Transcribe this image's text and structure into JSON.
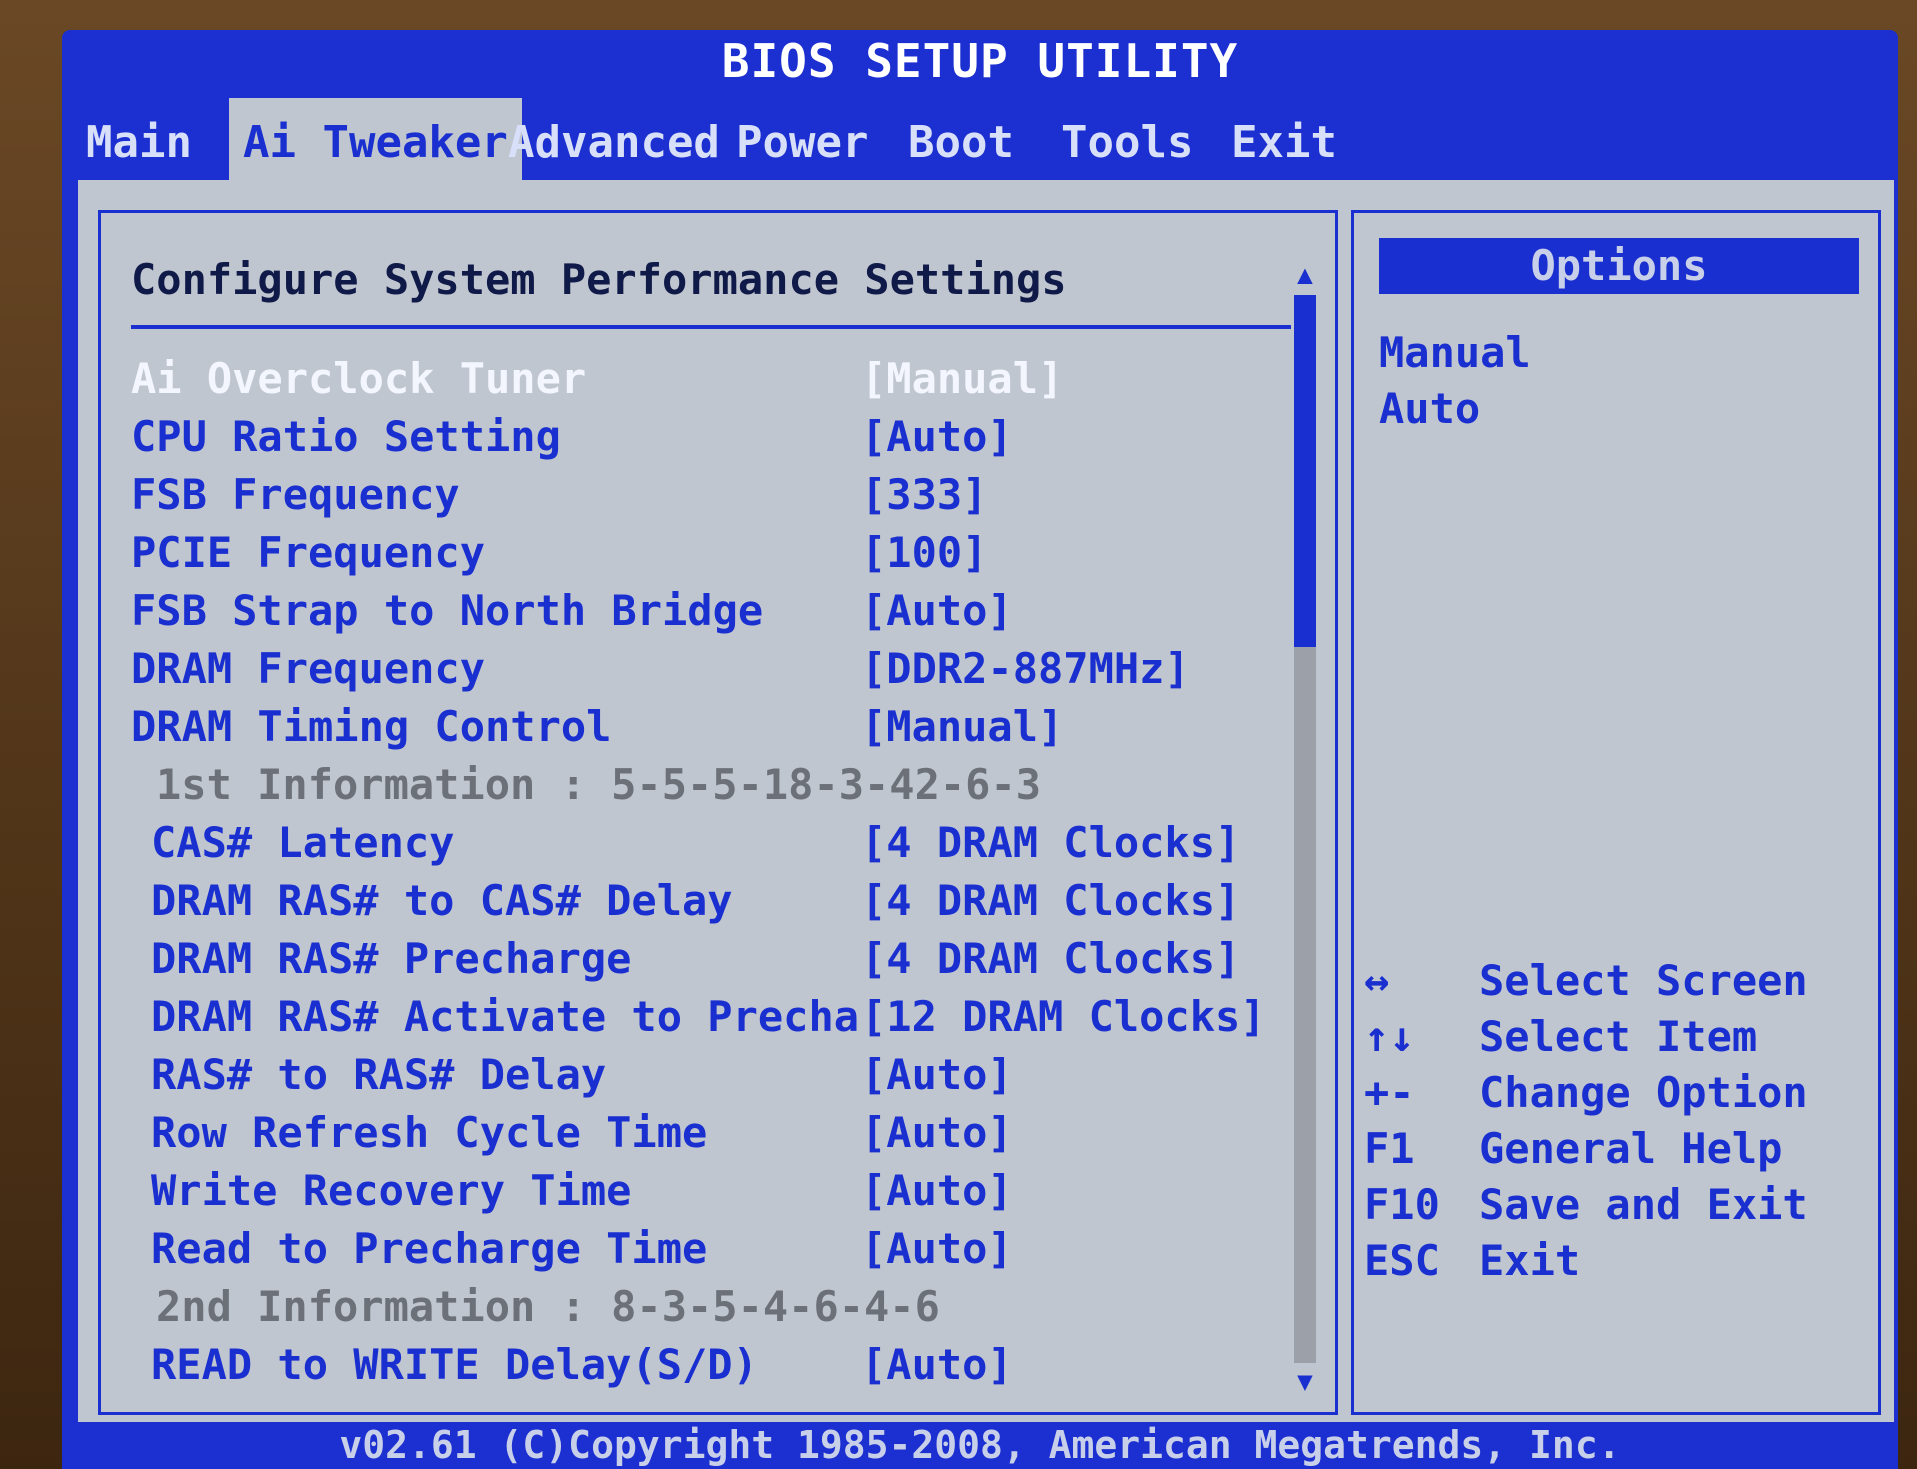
{
  "window": {
    "title": "BIOS SETUP UTILITY"
  },
  "menu": [
    {
      "label": "Main",
      "active": false
    },
    {
      "label": "Ai Tweaker",
      "active": true
    },
    {
      "label": "Advanced",
      "active": false
    },
    {
      "label": "Power",
      "active": false
    },
    {
      "label": "Boot",
      "active": false
    },
    {
      "label": "Tools",
      "active": false
    },
    {
      "label": "Exit",
      "active": false
    }
  ],
  "main": {
    "heading": "Configure System Performance Settings",
    "settings": [
      {
        "label": "Ai Overclock Tuner",
        "value": "[Manual]",
        "state": "highlighted"
      },
      {
        "label": "CPU Ratio Setting",
        "value": "[Auto]",
        "state": "normal"
      },
      {
        "label": "FSB Frequency",
        "value": "[333]",
        "state": "normal"
      },
      {
        "label": "PCIE Frequency",
        "value": "[100]",
        "state": "normal"
      },
      {
        "label": "FSB Strap to North Bridge",
        "value": "[Auto]",
        "state": "normal"
      },
      {
        "label": "DRAM Frequency",
        "value": "[DDR2-887MHz]",
        "state": "normal"
      },
      {
        "label": "DRAM Timing Control",
        "value": "[Manual]",
        "state": "normal"
      },
      {
        "label": "1st Information : 5-5-5-18-3-42-6-3",
        "value": "",
        "state": "info"
      },
      {
        "label": "CAS# Latency",
        "value": "[4 DRAM Clocks]",
        "state": "normal"
      },
      {
        "label": "DRAM RAS# to CAS# Delay",
        "value": "[4 DRAM Clocks]",
        "state": "normal"
      },
      {
        "label": "DRAM RAS# Precharge",
        "value": "[4 DRAM Clocks]",
        "state": "normal"
      },
      {
        "label": "DRAM RAS# Activate to Precha",
        "value": "[12 DRAM Clocks]",
        "state": "normal"
      },
      {
        "label": "RAS# to RAS# Delay",
        "value": "[Auto]",
        "state": "normal"
      },
      {
        "label": "Row Refresh Cycle Time",
        "value": "[Auto]",
        "state": "normal"
      },
      {
        "label": "Write Recovery Time",
        "value": "[Auto]",
        "state": "normal"
      },
      {
        "label": "Read to Precharge Time",
        "value": "[Auto]",
        "state": "normal"
      },
      {
        "label": "2nd Information : 8-3-5-4-6-4-6",
        "value": "",
        "state": "info"
      },
      {
        "label": "READ to WRITE Delay(S/D)",
        "value": "[Auto]",
        "state": "normal"
      }
    ],
    "scrollbar": {
      "up_icon": "up-arrow-icon",
      "down_icon": "down-arrow-icon",
      "position": 0.33
    }
  },
  "options_panel": {
    "heading": "Options",
    "options": [
      "Manual",
      "Auto"
    ],
    "keys": [
      {
        "key": "↔",
        "desc": "Select Screen"
      },
      {
        "key": "↑↓",
        "desc": "Select Item"
      },
      {
        "key": "+-",
        "desc": "Change Option"
      },
      {
        "key": "F1",
        "desc": "General Help"
      },
      {
        "key": "F10",
        "desc": "Save and Exit"
      },
      {
        "key": "ESC",
        "desc": "Exit"
      }
    ]
  },
  "footer": {
    "text": "v02.61 (C)Copyright 1985-2008, American Megatrends, Inc."
  },
  "colors": {
    "bios_blue": "#1a2fd0",
    "panel_grey": "#c0c6cf",
    "highlight": "#f4f6ff",
    "info_grey": "#6c7078"
  }
}
